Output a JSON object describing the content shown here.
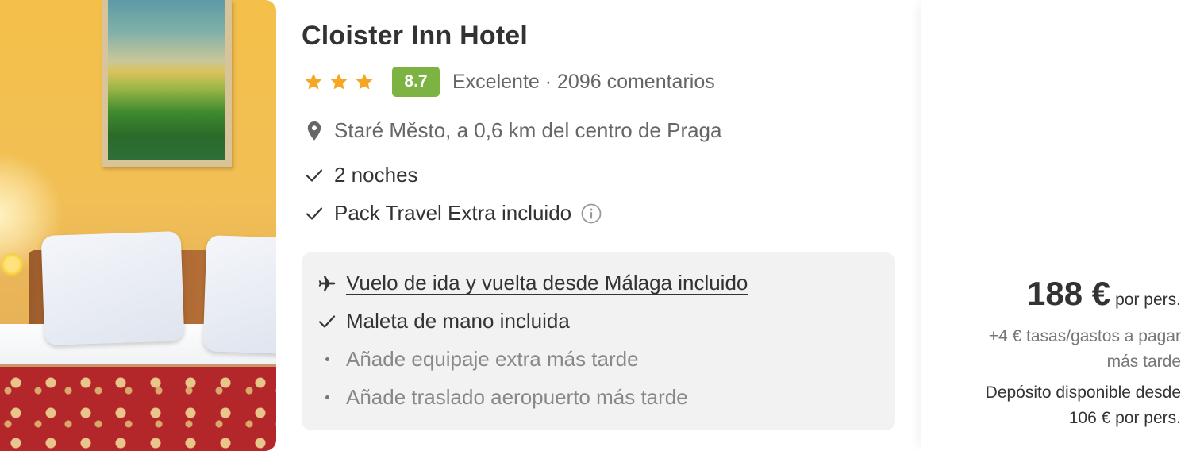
{
  "hotel": {
    "name": "Cloister Inn Hotel",
    "stars": 3,
    "score": "8.7",
    "rating_text": "Excelente · 2096 comentarios",
    "location": "Staré Město, a 0,6 km del centro de Praga",
    "inclusions": [
      "2 noches",
      "Pack Travel Extra incluido"
    ]
  },
  "flight_box": {
    "flight": "Vuelo de ida y vuelta desde Málaga incluido",
    "luggage": "Maleta de mano incluida",
    "extra_luggage": "Añade equipaje extra más tarde",
    "transfer": "Añade traslado aeropuerto más tarde"
  },
  "pricing": {
    "price": "188 €",
    "per": "por pers.",
    "fees_line1": "+4 € tasas/gastos a pagar",
    "fees_line2": "más tarde",
    "deposit_line1": "Depósito disponible desde",
    "deposit_line2": "106 € por pers."
  },
  "colors": {
    "score_bg": "#7cb342",
    "star": "#f5a623",
    "flight_box_bg": "#f2f2f2"
  },
  "icons": {
    "star": "star-icon",
    "location": "location-pin-icon",
    "check": "check-icon",
    "info": "info-icon",
    "plane": "plane-icon",
    "bullet": "bullet-dot-icon"
  }
}
